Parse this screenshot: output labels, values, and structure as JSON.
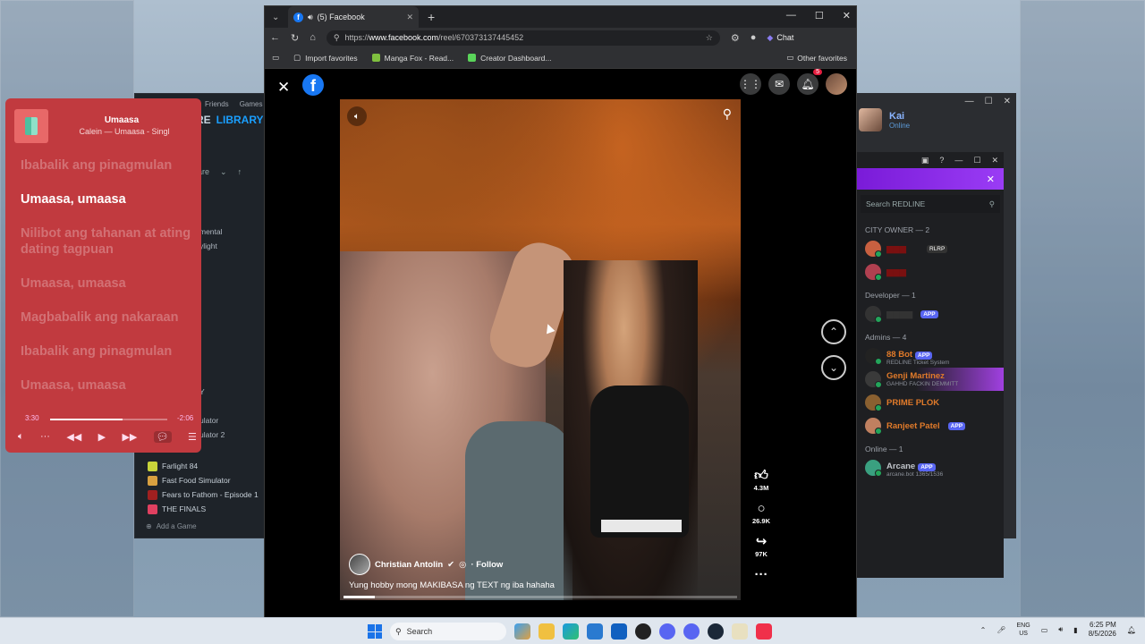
{
  "steam": {
    "nav_friends": "Friends",
    "nav_games": "Games",
    "tab_store": "RE",
    "tab_library": "LIBRARY",
    "filter": "are",
    "cat1": "mental",
    "cat2": "ylight",
    "cat3": "Y",
    "cat4": "ulator",
    "cat5": "ulator 2",
    "games": [
      "Farlight 84",
      "Fast Food Simulator",
      "Fears to Fathom - Episode 1",
      "THE FINALS"
    ],
    "add_game": "Add a Game"
  },
  "music": {
    "title": "Umaasa",
    "artist": "Calein — Umaasa - Singl",
    "lyrics": [
      "Ibabalik ang pinagmulan",
      "Umaasa, umaasa",
      "Nilibot ang tahanan at ating dating tagpuan",
      "Umaasa, umaasa",
      "Magbabalik ang nakaraan",
      "Ibabalik ang pinagmulan",
      "Umaasa, umaasa"
    ],
    "active_index": 1,
    "elapsed": "3:30",
    "remaining": "-2:06",
    "progress": 0.62,
    "accent": "#c13a3f"
  },
  "browser": {
    "tab_title": "(5) Facebook",
    "url_prefix": "https://",
    "url_host": "www.facebook.com",
    "url_path": "/reel/670373137445452",
    "chat_label": "Chat",
    "favorites": [
      "Import favorites",
      "Manga Fox - Read...",
      "Creator Dashboard..."
    ],
    "other_favorites": "Other favorites"
  },
  "facebook": {
    "notif_count": "5",
    "author": "Christian Antolin",
    "follow": "· Follow",
    "caption": "Yung hobby mong MAKIBASA ng TEXT ng iba hahaha",
    "likes": "4.3M",
    "comments": "26.9K",
    "shares": "97K",
    "video_progress": 0.08,
    "brand_color": "#1877f2"
  },
  "discord": {
    "user_name": "Kai",
    "user_status": "Online"
  },
  "redline": {
    "search_placeholder": "Search REDLINE",
    "groups": {
      "city_owner": "CITY OWNER — 2",
      "developer": "Developer — 1",
      "admins": "Admins — 4",
      "online": "Online — 1"
    },
    "members": {
      "city_owner_1_tag": "RLRP",
      "developer_1_tag": "APP",
      "admin_1_name": "88 Bot",
      "admin_1_tag": "APP",
      "admin_1_sub": "REDLINE Ticket System",
      "admin_2_name": "Genji Martinez",
      "admin_2_sub": "GAHHD FACKIN DEMMITT",
      "admin_3_name": "PRIME PLOK",
      "admin_4_name": "Ranjeet Patel",
      "admin_4_tag": "APP",
      "online_1_name": "Arcane",
      "online_1_tag": "APP",
      "online_1_sub": "arcane.bot 1365/1536"
    }
  },
  "taskbar": {
    "search": "Search",
    "lang_top": "ENG",
    "lang_bottom": "US",
    "time": "6:25 PM",
    "date": "8/5/2026"
  }
}
